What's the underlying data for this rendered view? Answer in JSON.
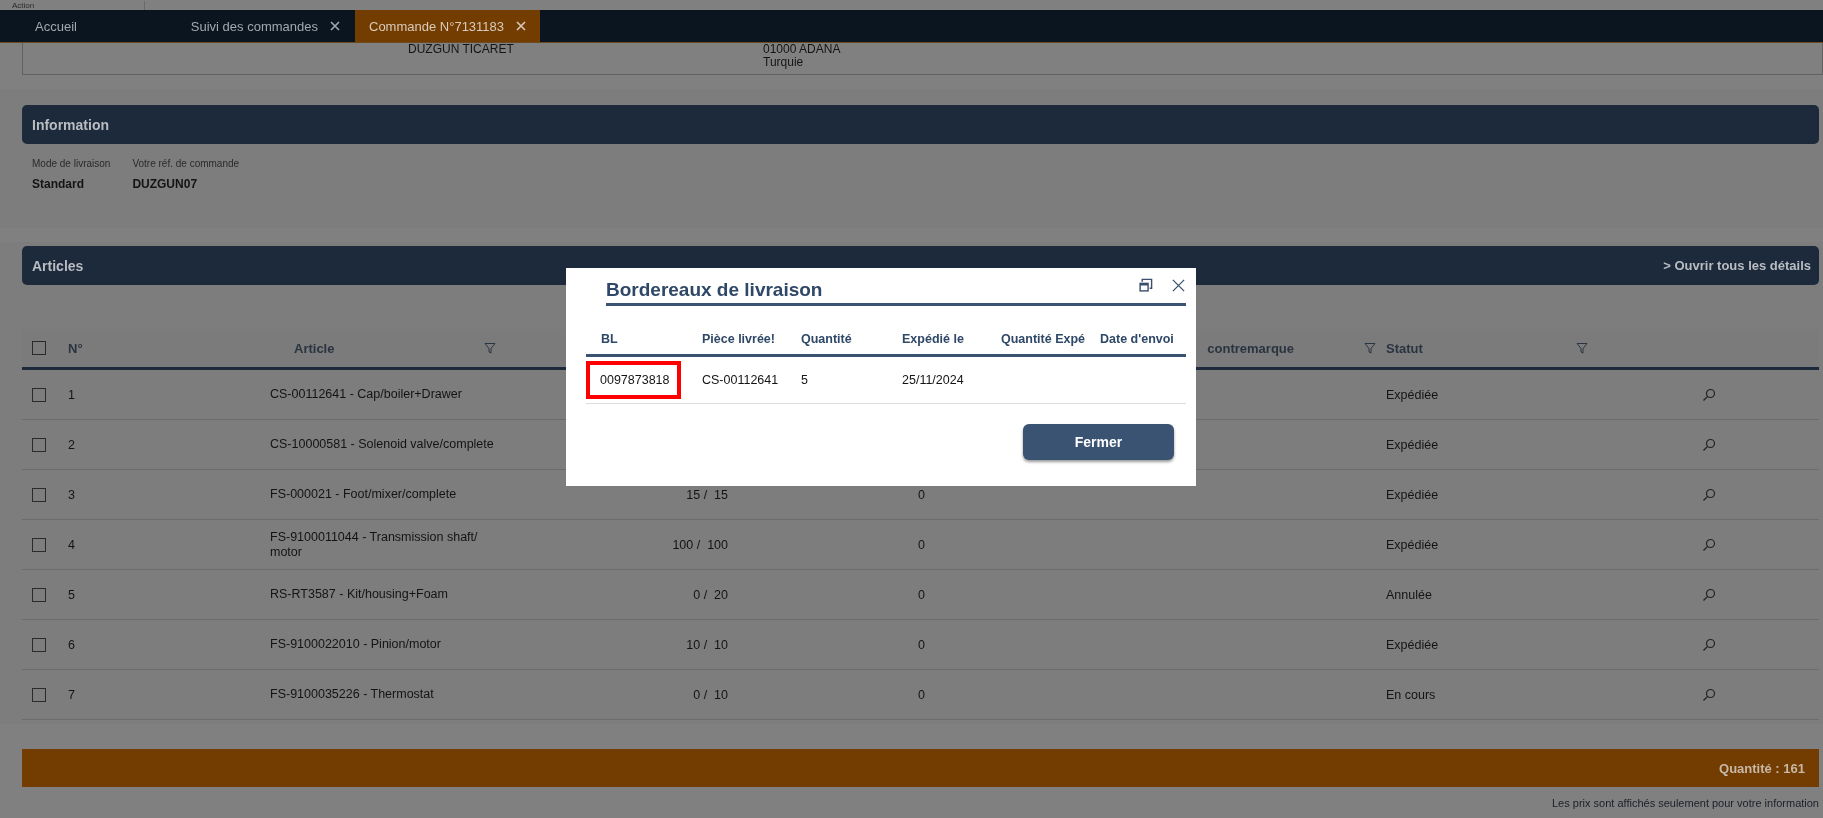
{
  "top_bar": {
    "label": "Action"
  },
  "tabs": [
    {
      "label": "Accueil",
      "closable": false,
      "selected": false
    },
    {
      "label": "Suivi des commandes",
      "closable": true,
      "selected": false
    },
    {
      "label": "Commande N°7131183",
      "closable": true,
      "selected": true
    }
  ],
  "address": {
    "column_1": [
      "DUZGUN TICARET"
    ],
    "column_2": [
      "01000 ADANA",
      "Turquie"
    ]
  },
  "information": {
    "title": "Information",
    "fields": [
      {
        "label": "Mode de livraison",
        "value": "Standard"
      },
      {
        "label": "Votre réf. de commande",
        "value": "DUZGUN07"
      }
    ]
  },
  "articles": {
    "title": "Articles",
    "details_link": "> Ouvrir tous les détails",
    "header_checked": false,
    "columns": [
      {
        "label": "N°"
      },
      {
        "label": "Article",
        "filter": true
      },
      {
        "label": "contremarque",
        "filter": true
      },
      {
        "label": "Statut",
        "filter": true
      }
    ],
    "rows": [
      {
        "checked": false,
        "n": "1",
        "article": "CS-00112641 - Cap/boiler+Drawer",
        "status": "Expédiée"
      },
      {
        "checked": false,
        "n": "2",
        "article": "CS-10000581 - Solenoid valve/complete",
        "status": "Expédiée"
      },
      {
        "checked": false,
        "n": "3",
        "article": "FS-000021 - Foot/mixer/complete",
        "quantity": "15 /  15",
        "column_4": "0",
        "status": "Expédiée"
      },
      {
        "checked": false,
        "n": "4",
        "article": "FS-9100011044 - Transmission shaft/ motor",
        "quantity": "100 /  100",
        "column_4": "0",
        "status": "Expédiée"
      },
      {
        "checked": false,
        "n": "5",
        "article": "RS-RT3587 - Kit/housing+Foam",
        "quantity": "0 /  20",
        "column_4": "0",
        "status": "Annulée"
      },
      {
        "checked": false,
        "n": "6",
        "article": "FS-9100022010 - Pinion/motor",
        "quantity": "10 /  10",
        "column_4": "0",
        "status": "Expédiée"
      },
      {
        "checked": false,
        "n": "7",
        "article": "FS-9100035226 - Thermostat",
        "quantity": "0 /  10",
        "column_4": "0",
        "status": "En cours"
      }
    ],
    "total": "Quantité : 161"
  },
  "footer_note": "Les prix sont affichés seulement pour votre information",
  "dialog": {
    "title": "Bordereaux de livraison",
    "columns": [
      "BL",
      "Pièce livrée!",
      "Quantité",
      "Expédié le",
      "Quantité Expé",
      "Date d'envoi"
    ],
    "rows": [
      {
        "highlighted": true,
        "cells": [
          "0097873818",
          "CS-00112641",
          "5",
          "25/11/2024"
        ]
      }
    ],
    "button": "Fermer"
  }
}
